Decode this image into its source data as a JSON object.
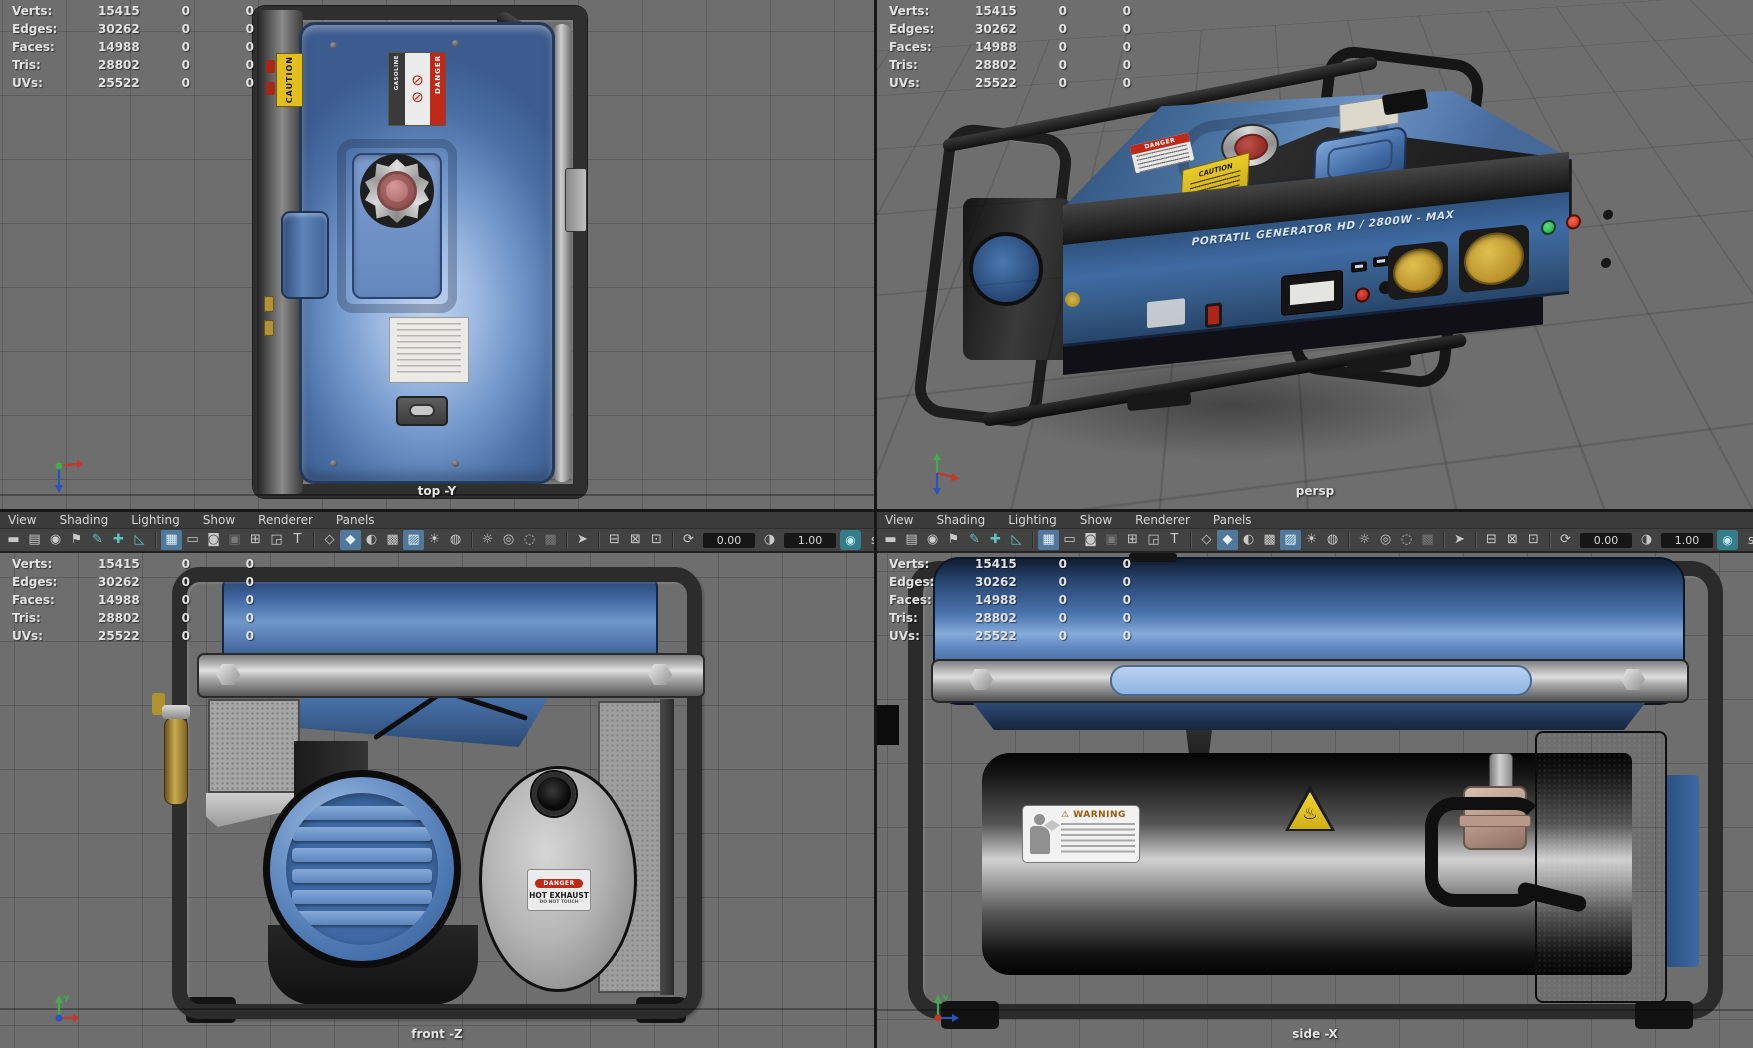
{
  "hud": {
    "rows": [
      {
        "label": "Verts:",
        "value": "15415",
        "c1": "0",
        "c2": "0"
      },
      {
        "label": "Edges:",
        "value": "30262",
        "c1": "0",
        "c2": "0"
      },
      {
        "label": "Faces:",
        "value": "14988",
        "c1": "0",
        "c2": "0"
      },
      {
        "label": "Tris:",
        "value": "28802",
        "c1": "0",
        "c2": "0"
      },
      {
        "label": "UVs:",
        "value": "25522",
        "c1": "0",
        "c2": "0"
      }
    ]
  },
  "menus": [
    "View",
    "Shading",
    "Lighting",
    "Show",
    "Renderer",
    "Panels"
  ],
  "toolbar": {
    "exposure": "0.00",
    "gamma": "1.00",
    "view_transform": "sRGB gamma",
    "items": [
      {
        "n": "select-camera-icon",
        "g": "▬"
      },
      {
        "n": "camera-attributes-icon",
        "g": "▤"
      },
      {
        "n": "camera-bookmarks-icon",
        "g": "◉"
      },
      {
        "n": "bookmark-icon",
        "g": "⚑"
      },
      {
        "n": "grease-pencil-icon",
        "g": "✎",
        "s": "teal"
      },
      {
        "n": "universal-manipulator-icon",
        "g": "✚",
        "s": "teal"
      },
      {
        "n": "measure-tool-icon",
        "g": "◺",
        "s": "teal"
      },
      {
        "sep": 1
      },
      {
        "n": "grid-icon",
        "g": "▦",
        "s": "active"
      },
      {
        "n": "film-gate-icon",
        "g": "▭"
      },
      {
        "n": "resolution-gate-icon",
        "g": "◙"
      },
      {
        "n": "gate-mask-icon",
        "g": "▣",
        "s": "dim"
      },
      {
        "n": "field-chart-icon",
        "g": "⊞"
      },
      {
        "n": "safe-action-icon",
        "g": "◲"
      },
      {
        "n": "safe-title-icon",
        "g": "T"
      },
      {
        "sep": 1
      },
      {
        "n": "wireframe-icon",
        "g": "◇"
      },
      {
        "n": "smooth-shade-icon",
        "g": "◆",
        "s": "active teal"
      },
      {
        "n": "use-default-material-icon",
        "g": "◐"
      },
      {
        "n": "textured-icon",
        "g": "▩"
      },
      {
        "n": "wireframe-on-shaded-icon",
        "g": "▨",
        "s": "active"
      },
      {
        "n": "lighting-icon",
        "g": "☀"
      },
      {
        "n": "shadows-icon",
        "g": "◍"
      },
      {
        "sep": 1
      },
      {
        "n": "use-all-lights-icon",
        "g": "☼"
      },
      {
        "n": "ambient-occlusion-icon",
        "g": "◎"
      },
      {
        "n": "motion-blur-icon",
        "g": "◌"
      },
      {
        "n": "multisampling-icon",
        "g": "▩",
        "s": "dim"
      },
      {
        "sep": 1
      },
      {
        "n": "isolate-select-icon",
        "g": "➤"
      },
      {
        "sep": 1
      },
      {
        "n": "xray-icon",
        "g": "⊟"
      },
      {
        "n": "xray-joints-icon",
        "g": "⊠"
      },
      {
        "n": "screen-space-icon",
        "g": "⊡"
      },
      {
        "sep": 1
      },
      {
        "n": "exposure-icon",
        "g": "⟳"
      },
      {
        "field": "exposure",
        "n": "exposure-field"
      },
      {
        "n": "gamma-icon",
        "g": "◑"
      },
      {
        "field": "gamma",
        "n": "gamma-field"
      },
      {
        "n": "color-management-icon",
        "g": "◉",
        "s": "cm"
      },
      {
        "dropdown": "view_transform",
        "n": "view-transform-dropdown"
      }
    ]
  },
  "viewports": {
    "top": {
      "label": "top -Y"
    },
    "persp": {
      "label": "persp"
    },
    "front": {
      "label": "front -Z"
    },
    "side": {
      "label": "side -X"
    }
  },
  "model": {
    "brand_line": "PORTATIL GENERATOR   HD / 2800W - MAX",
    "caution": "CAUTION",
    "danger": "DANGER",
    "gasoline": "GASOLINE",
    "warning": "⚠ WARNING",
    "hot_exhaust_title": "DANGER",
    "hot_exhaust_line1": "HOT EXHAUST",
    "hot_exhaust_line2": "DO NOT TOUCH",
    "prohibition_glyph": "⊘",
    "hot_surface_glyph": "♨"
  },
  "colors": {
    "viewport_bg": "#6e6e6e",
    "toolbar_active": "#50789c",
    "teal": "#5fc2bc",
    "tank_blue": "#4a74ad",
    "label_yellow": "#e2bf1e",
    "danger_red": "#c02818"
  }
}
